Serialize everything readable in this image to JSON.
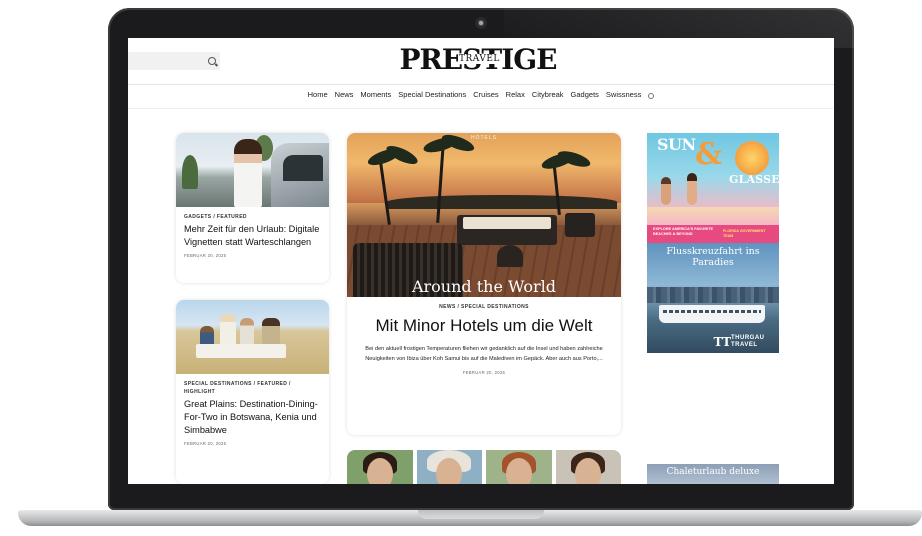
{
  "site": {
    "logo_main": "PRESTIGE",
    "logo_sub": "TRAVEL"
  },
  "nav": {
    "items": [
      "Home",
      "News",
      "Moments",
      "Special Destinations",
      "Cruises",
      "Relax",
      "Citybreak",
      "Gadgets",
      "Swissness"
    ]
  },
  "left": {
    "card1": {
      "category": "GADGETS / FEATURED",
      "title": "Mehr Zeit für den Urlaub: Digitale Vignetten statt Warteschlangen",
      "date": "FEBRUAR 20, 2025"
    },
    "card2": {
      "category": "SPECIAL DESTINATIONS / FEATURED / HIGHLIGHT",
      "title": "Great Plains: Destination-Dining-For-Two in Botswana, Kenia und Simbabwe",
      "date": "FEBRUAR 20, 2025"
    }
  },
  "hero": {
    "tag": "HOTELS",
    "image_caption": "Around the World",
    "category": "NEWS / SPECIAL DESTINATIONS",
    "title": "Mit Minor Hotels um die Welt",
    "excerpt": "Bei den aktuell frostigen Temperaturen fliehen wir gedanklich auf die Insel und haben zahlreiche Neuigkeiten von Ibiza über Koh Samui bis auf die Malediven im Gepäck. Aber auch aus Porto,...",
    "date": "FEBRUAR 20, 2025"
  },
  "ads": {
    "ad1": {
      "line1": "SUN",
      "amp": "&",
      "line2": "GLASSES",
      "footer_left": "EXPLORE AMERICA'S FAVORITE BEACHES & BEYOND",
      "footer_right": "FLORIDA GOVERNMENT TEAM"
    },
    "ad2": {
      "title": "Flusskreuzfahrt ins Paradies",
      "brand_icon": "TT",
      "brand": "THURGAU TRAVEL"
    },
    "ad3": {
      "title": "Chaleturlaub deluxe"
    }
  },
  "colors": {
    "ad_pink": "#e74a80",
    "ad_orange": "#f59c3a",
    "laptop_bezel": "#1b1b1d"
  }
}
